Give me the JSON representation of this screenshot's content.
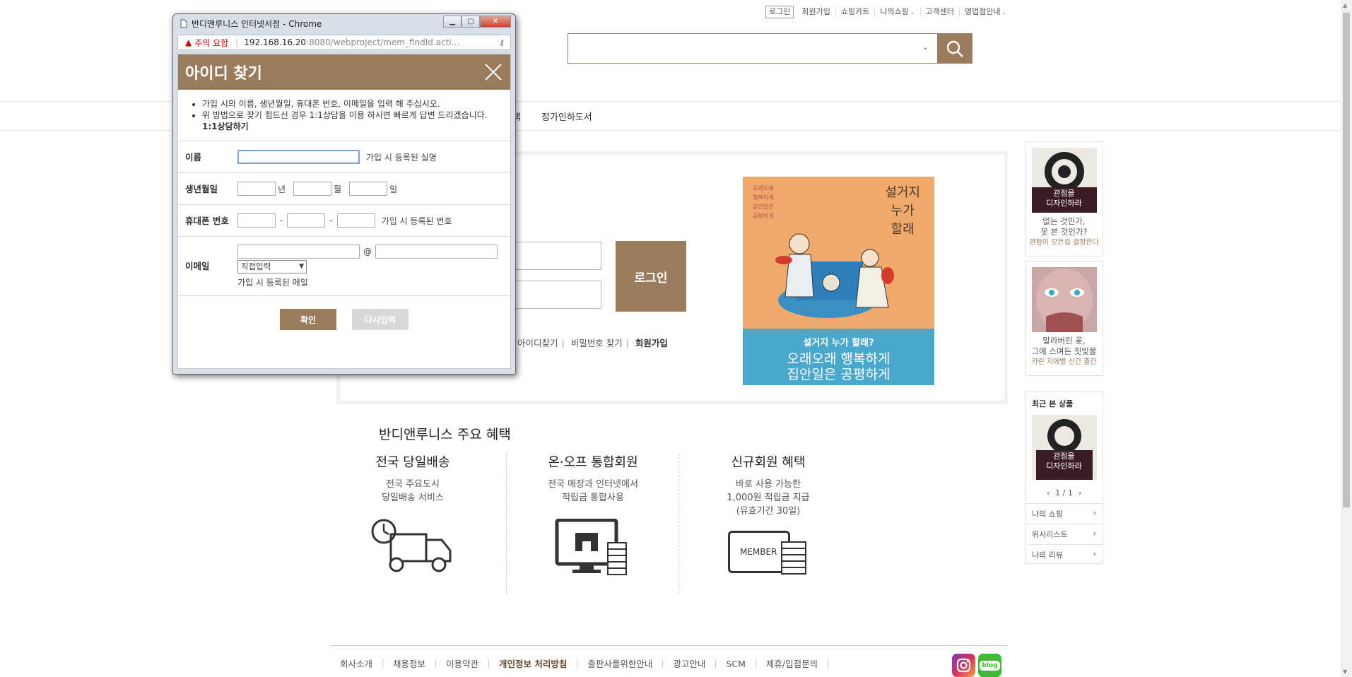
{
  "util_menu": {
    "login": "로그인",
    "join": "회원가입",
    "cart": "쇼핑카트",
    "myshop": "나의쇼핑",
    "cs": "고객센터",
    "store": "영업점안내"
  },
  "gnb": {
    "partial_item": "책",
    "subscription": "정가인하도서"
  },
  "login_panel": {
    "button": "로그인",
    "find_id": "아이디찾기",
    "find_pw": "비밀번호 찾기",
    "join": "회원가입"
  },
  "promo": {
    "book_title": "설거지\n누가\n할래",
    "side_text": "오래오래\n행복하게\n집안일은\n공평하게",
    "caption_1": "설거지 누가 할래?",
    "caption_2": "오래오래 행복하게\n집안일은 공평하게"
  },
  "benefits": {
    "title": "반디앤루니스 주요 혜택",
    "items": [
      {
        "title": "전국 당일배송",
        "desc": "전국 주요도시\n당일배송 서비스"
      },
      {
        "title": "온·오프 통합회원",
        "desc": "전국 매장과 인터넷에서\n적립금 통합사용"
      },
      {
        "title": "신규회원 혜택",
        "desc": "바로 사용 가능한\n1,000원 적립금 지급\n(유효기간 30일)"
      }
    ],
    "member_icon_text": "MEMBER"
  },
  "sidebar": {
    "ad1": {
      "cover": "관점을\n디자인하라",
      "line1": "없는 것인가,",
      "line2": "못 본 것인가?",
      "line3": "관점이 모든걸 결정한다"
    },
    "ad2": {
      "line1": "말라버린 꽃,",
      "line2": "그에 스며든 핏빛물",
      "line3": "카린 지에벨 신간 출간"
    },
    "recent_title": "최근 본 상품",
    "recent_cover": "관점을\n디자인하라",
    "pager": "1 / 1",
    "menu": [
      "나의 쇼핑",
      "위시리스트",
      "나의 리뷰"
    ]
  },
  "footer": {
    "links": [
      "회사소개",
      "채용정보",
      "이용약관",
      "개인정보 처리방침",
      "출판사를위한안내",
      "광고안내",
      "SCM",
      "제휴/입점문의"
    ],
    "blog": "blog"
  },
  "popup": {
    "window_title": "반디앤루니스 인터넷서점 - Chrome",
    "security_warning": "주의 요함",
    "url_host": "192.168.16.20",
    "url_path": ":8080/webproject/mem_findId.acti...",
    "heading": "아이디 찾기",
    "guide_1": "가입 시의 이름, 생년월일, 휴대폰 번호, 이메일을 입력 해 주십시오.",
    "guide_2": "위 방법으로 찾기 힘드신 경우 1:1상담을 이용 하시면 빠르게 답변 드리겠습니다.",
    "guide_link": "1:1상담하기",
    "name_label": "이름",
    "name_hint": "가입 시 등록된 실명",
    "birth_label": "생년월일",
    "year": "년",
    "month": "월",
    "day": "일",
    "phone_label": "휴대폰 번호",
    "phone_dash": "-",
    "phone_hint": "가입 시 등록된 번호",
    "email_label": "이메일",
    "email_at": "@",
    "email_select": "직접입력",
    "email_hint": "가입 시 등록된 메일",
    "confirm": "확인",
    "reset": "다시입력"
  },
  "colors": {
    "brand": "#9a7b5c",
    "promo_blue": "#4aa8cc",
    "warning": "#cc0000"
  }
}
